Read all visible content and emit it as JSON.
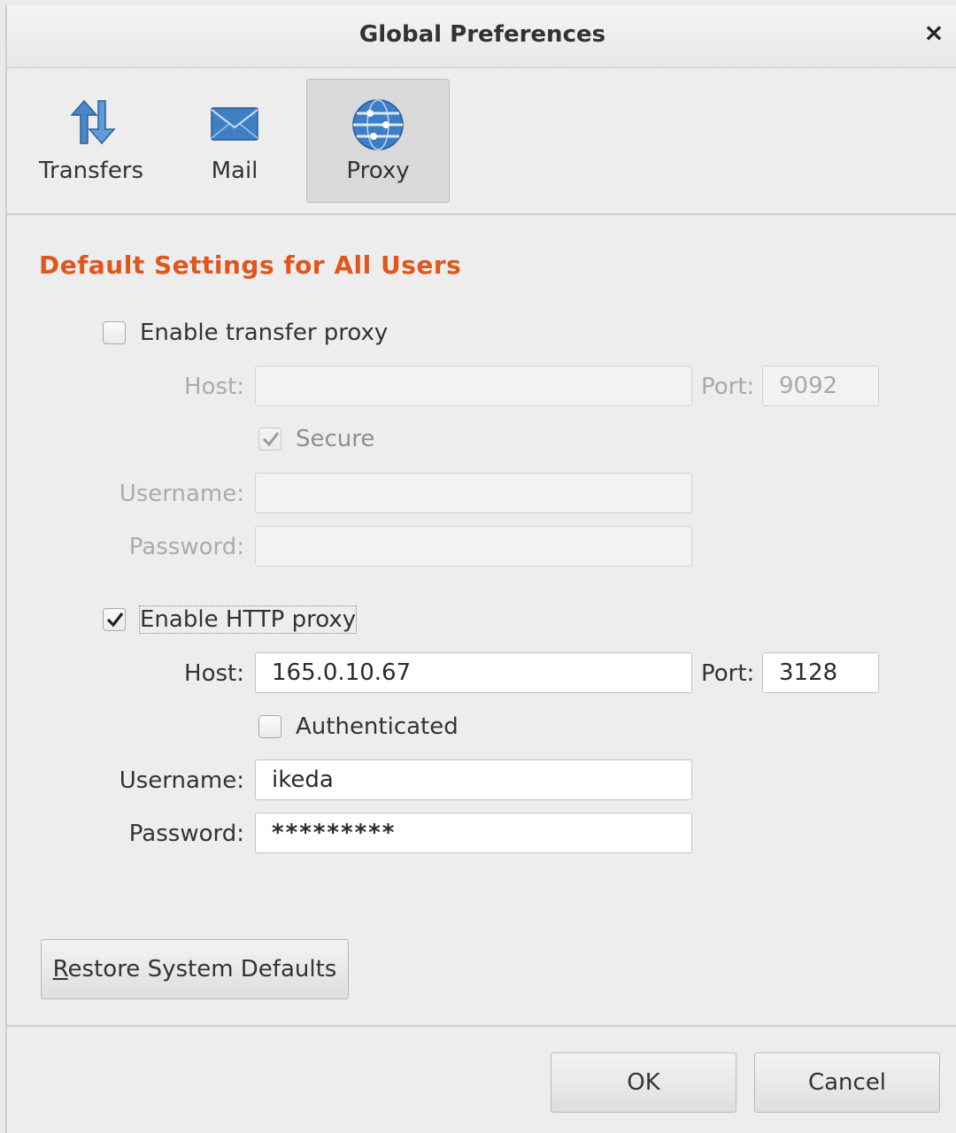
{
  "window": {
    "title": "Global Preferences",
    "close_glyph": "×"
  },
  "tabs": [
    {
      "label": "Transfers",
      "icon": "transfer-arrows-icon",
      "active": false
    },
    {
      "label": "Mail",
      "icon": "envelope-icon",
      "active": false
    },
    {
      "label": "Proxy",
      "icon": "globe-network-icon",
      "active": true
    }
  ],
  "section": {
    "heading": "Default Settings for All Users",
    "heading_color": "#e0561c"
  },
  "transfer_proxy": {
    "enable_label": "Enable transfer proxy",
    "enabled": false,
    "host_label": "Host:",
    "host_value": "",
    "port_label": "Port:",
    "port_value": "9092",
    "secure_label": "Secure",
    "secure_checked": true,
    "username_label": "Username:",
    "username_value": "",
    "password_label": "Password:",
    "password_value": ""
  },
  "http_proxy": {
    "enable_label": "Enable HTTP proxy",
    "enabled": true,
    "host_label": "Host:",
    "host_value": "165.0.10.67",
    "port_label": "Port:",
    "port_value": "3128",
    "auth_label": "Authenticated",
    "auth_checked": false,
    "username_label": "Username:",
    "username_value": "ikeda",
    "password_label": "Password:",
    "password_value": "*********"
  },
  "buttons": {
    "restore_label": "Restore System Defaults",
    "restore_mnemonic": "R",
    "restore_rest": "estore System Defaults",
    "ok_label": "OK",
    "cancel_label": "Cancel"
  }
}
